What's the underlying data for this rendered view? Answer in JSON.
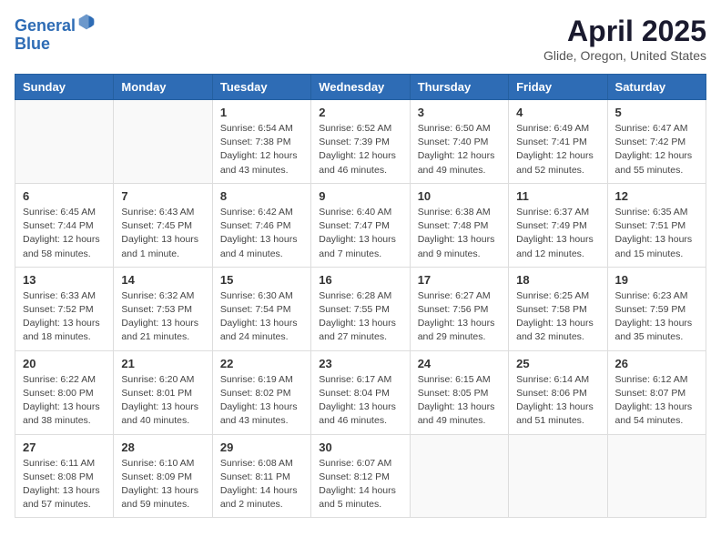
{
  "header": {
    "logo_line1": "General",
    "logo_line2": "Blue",
    "month_title": "April 2025",
    "location": "Glide, Oregon, United States"
  },
  "weekdays": [
    "Sunday",
    "Monday",
    "Tuesday",
    "Wednesday",
    "Thursday",
    "Friday",
    "Saturday"
  ],
  "weeks": [
    [
      {
        "day": "",
        "info": ""
      },
      {
        "day": "",
        "info": ""
      },
      {
        "day": "1",
        "info": "Sunrise: 6:54 AM\nSunset: 7:38 PM\nDaylight: 12 hours and 43 minutes."
      },
      {
        "day": "2",
        "info": "Sunrise: 6:52 AM\nSunset: 7:39 PM\nDaylight: 12 hours and 46 minutes."
      },
      {
        "day": "3",
        "info": "Sunrise: 6:50 AM\nSunset: 7:40 PM\nDaylight: 12 hours and 49 minutes."
      },
      {
        "day": "4",
        "info": "Sunrise: 6:49 AM\nSunset: 7:41 PM\nDaylight: 12 hours and 52 minutes."
      },
      {
        "day": "5",
        "info": "Sunrise: 6:47 AM\nSunset: 7:42 PM\nDaylight: 12 hours and 55 minutes."
      }
    ],
    [
      {
        "day": "6",
        "info": "Sunrise: 6:45 AM\nSunset: 7:44 PM\nDaylight: 12 hours and 58 minutes."
      },
      {
        "day": "7",
        "info": "Sunrise: 6:43 AM\nSunset: 7:45 PM\nDaylight: 13 hours and 1 minute."
      },
      {
        "day": "8",
        "info": "Sunrise: 6:42 AM\nSunset: 7:46 PM\nDaylight: 13 hours and 4 minutes."
      },
      {
        "day": "9",
        "info": "Sunrise: 6:40 AM\nSunset: 7:47 PM\nDaylight: 13 hours and 7 minutes."
      },
      {
        "day": "10",
        "info": "Sunrise: 6:38 AM\nSunset: 7:48 PM\nDaylight: 13 hours and 9 minutes."
      },
      {
        "day": "11",
        "info": "Sunrise: 6:37 AM\nSunset: 7:49 PM\nDaylight: 13 hours and 12 minutes."
      },
      {
        "day": "12",
        "info": "Sunrise: 6:35 AM\nSunset: 7:51 PM\nDaylight: 13 hours and 15 minutes."
      }
    ],
    [
      {
        "day": "13",
        "info": "Sunrise: 6:33 AM\nSunset: 7:52 PM\nDaylight: 13 hours and 18 minutes."
      },
      {
        "day": "14",
        "info": "Sunrise: 6:32 AM\nSunset: 7:53 PM\nDaylight: 13 hours and 21 minutes."
      },
      {
        "day": "15",
        "info": "Sunrise: 6:30 AM\nSunset: 7:54 PM\nDaylight: 13 hours and 24 minutes."
      },
      {
        "day": "16",
        "info": "Sunrise: 6:28 AM\nSunset: 7:55 PM\nDaylight: 13 hours and 27 minutes."
      },
      {
        "day": "17",
        "info": "Sunrise: 6:27 AM\nSunset: 7:56 PM\nDaylight: 13 hours and 29 minutes."
      },
      {
        "day": "18",
        "info": "Sunrise: 6:25 AM\nSunset: 7:58 PM\nDaylight: 13 hours and 32 minutes."
      },
      {
        "day": "19",
        "info": "Sunrise: 6:23 AM\nSunset: 7:59 PM\nDaylight: 13 hours and 35 minutes."
      }
    ],
    [
      {
        "day": "20",
        "info": "Sunrise: 6:22 AM\nSunset: 8:00 PM\nDaylight: 13 hours and 38 minutes."
      },
      {
        "day": "21",
        "info": "Sunrise: 6:20 AM\nSunset: 8:01 PM\nDaylight: 13 hours and 40 minutes."
      },
      {
        "day": "22",
        "info": "Sunrise: 6:19 AM\nSunset: 8:02 PM\nDaylight: 13 hours and 43 minutes."
      },
      {
        "day": "23",
        "info": "Sunrise: 6:17 AM\nSunset: 8:04 PM\nDaylight: 13 hours and 46 minutes."
      },
      {
        "day": "24",
        "info": "Sunrise: 6:15 AM\nSunset: 8:05 PM\nDaylight: 13 hours and 49 minutes."
      },
      {
        "day": "25",
        "info": "Sunrise: 6:14 AM\nSunset: 8:06 PM\nDaylight: 13 hours and 51 minutes."
      },
      {
        "day": "26",
        "info": "Sunrise: 6:12 AM\nSunset: 8:07 PM\nDaylight: 13 hours and 54 minutes."
      }
    ],
    [
      {
        "day": "27",
        "info": "Sunrise: 6:11 AM\nSunset: 8:08 PM\nDaylight: 13 hours and 57 minutes."
      },
      {
        "day": "28",
        "info": "Sunrise: 6:10 AM\nSunset: 8:09 PM\nDaylight: 13 hours and 59 minutes."
      },
      {
        "day": "29",
        "info": "Sunrise: 6:08 AM\nSunset: 8:11 PM\nDaylight: 14 hours and 2 minutes."
      },
      {
        "day": "30",
        "info": "Sunrise: 6:07 AM\nSunset: 8:12 PM\nDaylight: 14 hours and 5 minutes."
      },
      {
        "day": "",
        "info": ""
      },
      {
        "day": "",
        "info": ""
      },
      {
        "day": "",
        "info": ""
      }
    ]
  ]
}
